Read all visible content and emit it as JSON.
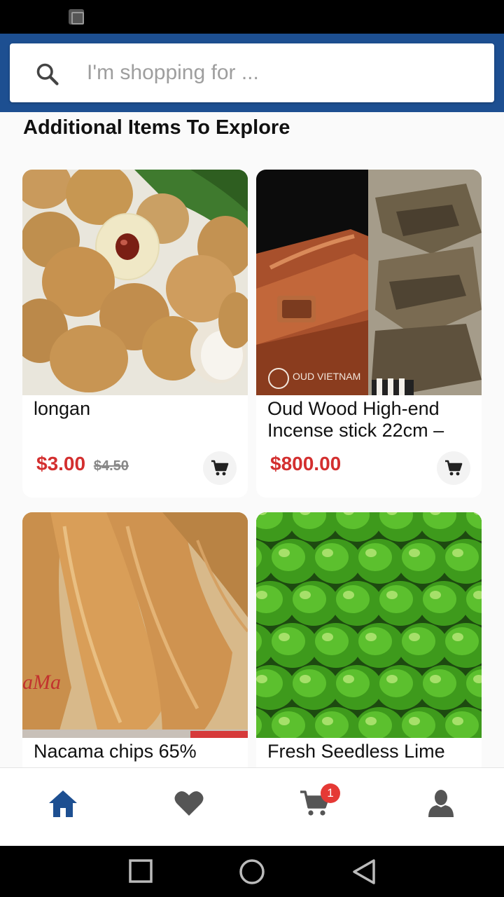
{
  "search": {
    "placeholder": "I'm shopping for ..."
  },
  "section": {
    "title": "Additional Items To Explore"
  },
  "products": [
    {
      "name": "longan",
      "price": "$3.00",
      "old_price": "$4.50",
      "image": "longan-photo"
    },
    {
      "name": "Oud Wood High-end Incense stick 22cm –",
      "price": "$800.00",
      "old_price": "",
      "image": "oud-incense-photo",
      "watermark": "OUD VIETNAM"
    },
    {
      "name": "Nacama chips 65%",
      "image": "jackfruit-chips-photo",
      "watermark": "aMa"
    },
    {
      "name": "Fresh Seedless Lime",
      "image": "limes-photo"
    }
  ],
  "bottom_nav": {
    "items": [
      "home-icon",
      "heart-icon",
      "cart-icon",
      "account-icon"
    ],
    "cart_badge": "1",
    "active_color": "#1d4f91",
    "inactive_color": "#555555"
  },
  "colors": {
    "header": "#1d4f91",
    "price": "#d32f2f",
    "badge": "#e53935"
  }
}
